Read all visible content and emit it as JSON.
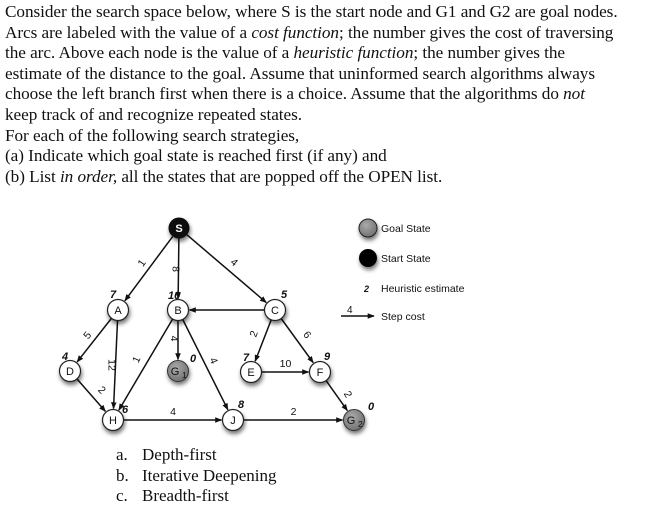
{
  "problem": {
    "lines": [
      [
        {
          "t": "Consider the search space below, where S is the start node and G1 and G2 are goal nodes."
        }
      ],
      [
        {
          "t": "Arcs are labeled with the value of a "
        },
        {
          "t": "cost function",
          "i": true
        },
        {
          "t": "; the number gives the cost of traversing"
        }
      ],
      [
        {
          "t": "the arc. Above each node is the value of a "
        },
        {
          "t": "heuristic function",
          "i": true
        },
        {
          "t": "; the number gives the"
        }
      ],
      [
        {
          "t": "estimate of the distance to the goal. Assume that uninformed search algorithms always"
        }
      ],
      [
        {
          "t": "choose the left branch first when there is a choice. Assume that the algorithms do "
        },
        {
          "t": "not",
          "i": true
        }
      ],
      [
        {
          "t": "keep track of and recognize repeated states."
        }
      ],
      [
        {
          "t": "For each of the following search strategies,"
        }
      ],
      [
        {
          "t": "(a) Indicate which goal state is reached first (if any) and"
        }
      ],
      [
        {
          "t": "(b) List "
        },
        {
          "t": "in order,",
          "i": true
        },
        {
          "t": " all the states that are popped off the OPEN list."
        }
      ]
    ]
  },
  "graph": {
    "colors": {
      "start": "#0a0a0a",
      "goal": "#8a8a8a",
      "normal": "#ffffff",
      "edge": "#111111"
    },
    "nodes": [
      {
        "id": "S",
        "label": "S",
        "type": "start",
        "h": ""
      },
      {
        "id": "A",
        "label": "A",
        "type": "normal",
        "h": "7"
      },
      {
        "id": "B",
        "label": "B",
        "type": "normal",
        "h": "10"
      },
      {
        "id": "C",
        "label": "C",
        "type": "normal",
        "h": "5"
      },
      {
        "id": "D",
        "label": "D",
        "type": "normal",
        "h": "4"
      },
      {
        "id": "G1",
        "label": "G",
        "sub": "1",
        "type": "goal",
        "h": "0"
      },
      {
        "id": "E",
        "label": "E",
        "type": "normal",
        "h": "7"
      },
      {
        "id": "F",
        "label": "F",
        "type": "normal",
        "h": "9"
      },
      {
        "id": "H",
        "label": "H",
        "type": "normal",
        "h": "6"
      },
      {
        "id": "J",
        "label": "J",
        "type": "normal",
        "h": "8"
      },
      {
        "id": "G2",
        "label": "G",
        "sub": "2",
        "type": "goal",
        "h": "0"
      }
    ],
    "edges": [
      {
        "from": "S",
        "to": "A",
        "cost": "1"
      },
      {
        "from": "S",
        "to": "B",
        "cost": "8"
      },
      {
        "from": "S",
        "to": "C",
        "cost": "4"
      },
      {
        "from": "C",
        "to": "B",
        "cost": ""
      },
      {
        "from": "A",
        "to": "D",
        "cost": "5"
      },
      {
        "from": "A",
        "to": "H",
        "cost": "12"
      },
      {
        "from": "B",
        "to": "H",
        "cost": "1"
      },
      {
        "from": "B",
        "to": "G1",
        "cost": "4"
      },
      {
        "from": "B",
        "to": "J",
        "cost": "4"
      },
      {
        "from": "C",
        "to": "E",
        "cost": "2"
      },
      {
        "from": "C",
        "to": "F",
        "cost": "6"
      },
      {
        "from": "D",
        "to": "H",
        "cost": "2"
      },
      {
        "from": "E",
        "to": "F",
        "cost": "10"
      },
      {
        "from": "F",
        "to": "G2",
        "cost": "2"
      },
      {
        "from": "H",
        "to": "J",
        "cost": "4"
      },
      {
        "from": "J",
        "to": "G2",
        "cost": "2"
      }
    ]
  },
  "legend": {
    "goal_label": "Goal State",
    "start_label": "Start State",
    "heuristic_sample": "2",
    "heuristic_label": "Heuristic estimate",
    "cost_sample": "4",
    "cost_label": "Step cost"
  },
  "strategies": [
    {
      "marker": "a.",
      "label": "Depth-first"
    },
    {
      "marker": "b.",
      "label": "Iterative Deepening"
    },
    {
      "marker": "c.",
      "label": "Breadth-first"
    }
  ]
}
